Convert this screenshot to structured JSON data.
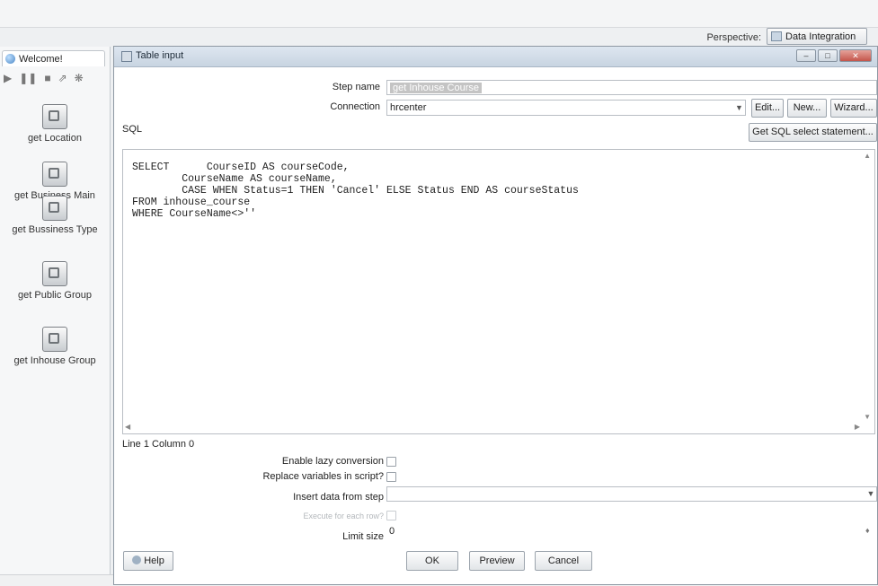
{
  "app": {
    "perspective_label": "Perspective:",
    "perspective_value": "Data Integration"
  },
  "left_panel": {
    "tab_label": "Welcome!",
    "steps": [
      "get Location",
      "get Business Main",
      "get Bussiness Type",
      "get Public Group",
      "get Inhouse Group"
    ]
  },
  "dialog": {
    "title": "Table input",
    "step_name_label": "Step name",
    "step_name_value": "get Inhouse Course",
    "connection_label": "Connection",
    "connection_value": "hrcenter",
    "edit_button": "Edit...",
    "new_button": "New...",
    "wizard_button": "Wizard...",
    "sql_label": "SQL",
    "get_sql_button": "Get SQL select statement...",
    "sql_lines": [
      "SELECT      CourseID AS courseCode,",
      "        CourseName AS courseName,",
      "        CASE WHEN Status=1 THEN 'Cancel' ELSE Status END AS courseStatus",
      "FROM inhouse_course",
      "WHERE CourseName<>''"
    ],
    "cursor_position": "Line 1 Column 0",
    "lazy_conversion_label": "Enable lazy conversion",
    "lazy_conversion_checked": false,
    "replace_vars_label": "Replace variables in script?",
    "replace_vars_checked": false,
    "insert_from_step_label": "Insert data from step",
    "insert_from_step_value": "",
    "execute_each_row_label": "Execute for each row?",
    "execute_each_row_checked": false,
    "limit_size_label": "Limit size",
    "limit_size_value": "0",
    "help_button": "Help",
    "ok_button": "OK",
    "preview_button": "Preview",
    "cancel_button": "Cancel"
  }
}
